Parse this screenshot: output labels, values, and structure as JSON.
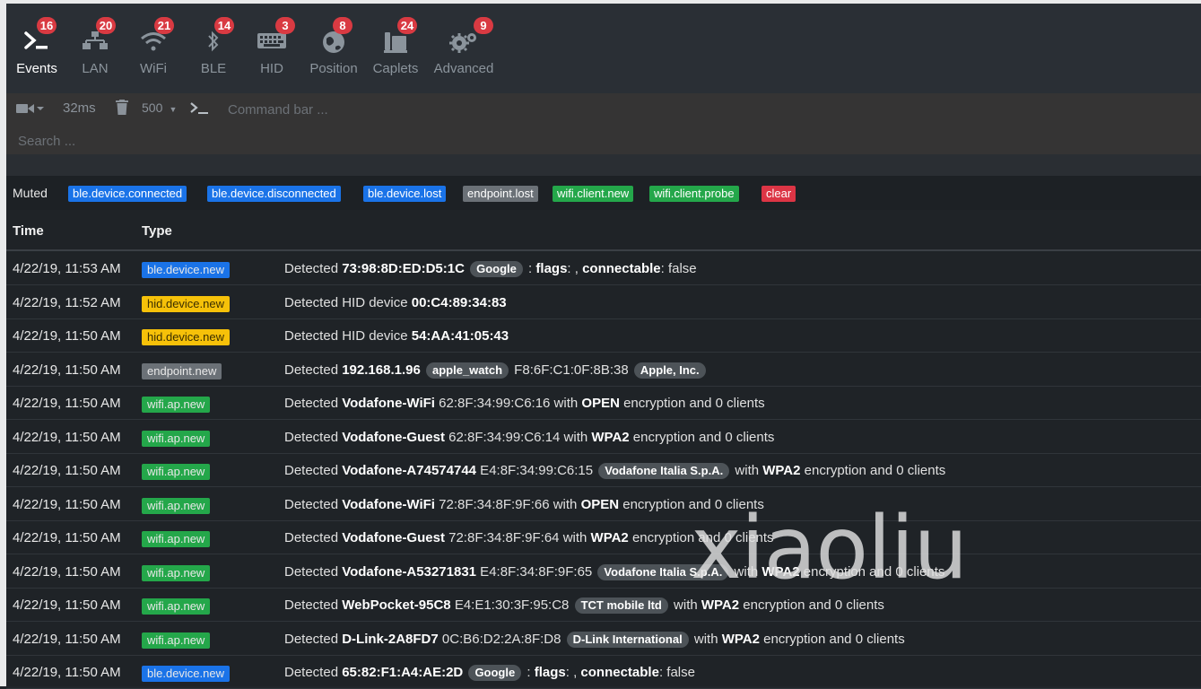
{
  "nav": {
    "items": [
      {
        "label": "Events",
        "badge": "16",
        "icon": "terminal-icon"
      },
      {
        "label": "LAN",
        "badge": "20",
        "icon": "network-icon"
      },
      {
        "label": "WiFi",
        "badge": "21",
        "icon": "wifi-icon"
      },
      {
        "label": "BLE",
        "badge": "14",
        "icon": "bluetooth-icon"
      },
      {
        "label": "HID",
        "badge": "3",
        "icon": "keyboard-icon"
      },
      {
        "label": "Position",
        "badge": "8",
        "icon": "globe-icon"
      },
      {
        "label": "Caplets",
        "badge": "24",
        "icon": "caplets-icon"
      },
      {
        "label": "Advanced",
        "badge": "9",
        "icon": "gears-icon"
      }
    ]
  },
  "toolbar": {
    "refresh": "32ms",
    "limit": "500",
    "command_placeholder": "Command bar ...",
    "search_placeholder": "Search ..."
  },
  "muted": {
    "label": "Muted",
    "tags": [
      "ble.device.connected",
      "ble.device.disconnected",
      "ble.device.lost",
      "endpoint.lost",
      "wifi.client.new",
      "wifi.client.probe"
    ],
    "clear_label": "clear"
  },
  "table": {
    "headers": {
      "time": "Time",
      "type": "Type"
    },
    "rows": [
      {
        "time": "4/22/19, 11:53 AM",
        "type": "ble.device.new",
        "msg": [
          {
            "t": "Detected "
          },
          {
            "t": "73:98:8D:ED:D5:1C",
            "b": 1
          },
          {
            "t": " "
          },
          {
            "t": "Google",
            "p": 1
          },
          {
            "t": " : "
          },
          {
            "t": "flags",
            "b": 1
          },
          {
            "t": ": , "
          },
          {
            "t": "connectable",
            "b": 1
          },
          {
            "t": ": false"
          }
        ]
      },
      {
        "time": "4/22/19, 11:52 AM",
        "type": "hid.device.new",
        "msg": [
          {
            "t": "Detected HID device "
          },
          {
            "t": "00:C4:89:34:83",
            "b": 1
          }
        ]
      },
      {
        "time": "4/22/19, 11:50 AM",
        "type": "hid.device.new",
        "msg": [
          {
            "t": "Detected HID device "
          },
          {
            "t": "54:AA:41:05:43",
            "b": 1
          }
        ]
      },
      {
        "time": "4/22/19, 11:50 AM",
        "type": "endpoint.new",
        "msg": [
          {
            "t": "Detected "
          },
          {
            "t": "192.168.1.96",
            "b": 1
          },
          {
            "t": " "
          },
          {
            "t": "apple_watch",
            "p": 1
          },
          {
            "t": " F8:6F:C1:0F:8B:38 "
          },
          {
            "t": "Apple, Inc.",
            "p": 1
          }
        ]
      },
      {
        "time": "4/22/19, 11:50 AM",
        "type": "wifi.ap.new",
        "msg": [
          {
            "t": "Detected "
          },
          {
            "t": "Vodafone-WiFi",
            "b": 1
          },
          {
            "t": " 62:8F:34:99:C6:16 with "
          },
          {
            "t": "OPEN",
            "b": 1
          },
          {
            "t": " encryption and 0 clients"
          }
        ]
      },
      {
        "time": "4/22/19, 11:50 AM",
        "type": "wifi.ap.new",
        "msg": [
          {
            "t": "Detected "
          },
          {
            "t": "Vodafone-Guest",
            "b": 1
          },
          {
            "t": " 62:8F:34:99:C6:14 with "
          },
          {
            "t": "WPA2",
            "b": 1
          },
          {
            "t": " encryption and 0 clients"
          }
        ]
      },
      {
        "time": "4/22/19, 11:50 AM",
        "type": "wifi.ap.new",
        "msg": [
          {
            "t": "Detected "
          },
          {
            "t": "Vodafone-A74574744",
            "b": 1
          },
          {
            "t": " E4:8F:34:99:C6:15 "
          },
          {
            "t": "Vodafone Italia S.p.A.",
            "p": 1
          },
          {
            "t": " with "
          },
          {
            "t": "WPA2",
            "b": 1
          },
          {
            "t": " encryption and 0 clients"
          }
        ]
      },
      {
        "time": "4/22/19, 11:50 AM",
        "type": "wifi.ap.new",
        "msg": [
          {
            "t": "Detected "
          },
          {
            "t": "Vodafone-WiFi",
            "b": 1
          },
          {
            "t": " 72:8F:34:8F:9F:66 with "
          },
          {
            "t": "OPEN",
            "b": 1
          },
          {
            "t": " encryption and 0 clients"
          }
        ]
      },
      {
        "time": "4/22/19, 11:50 AM",
        "type": "wifi.ap.new",
        "msg": [
          {
            "t": "Detected "
          },
          {
            "t": "Vodafone-Guest",
            "b": 1
          },
          {
            "t": " 72:8F:34:8F:9F:64 with "
          },
          {
            "t": "WPA2",
            "b": 1
          },
          {
            "t": " encryption and 0 clients"
          }
        ]
      },
      {
        "time": "4/22/19, 11:50 AM",
        "type": "wifi.ap.new",
        "msg": [
          {
            "t": "Detected "
          },
          {
            "t": "Vodafone-A53271831",
            "b": 1
          },
          {
            "t": " E4:8F:34:8F:9F:65 "
          },
          {
            "t": "Vodafone Italia S.p.A.",
            "p": 1
          },
          {
            "t": " with "
          },
          {
            "t": "WPA2",
            "b": 1
          },
          {
            "t": " encryption and 0 clients"
          }
        ]
      },
      {
        "time": "4/22/19, 11:50 AM",
        "type": "wifi.ap.new",
        "msg": [
          {
            "t": "Detected "
          },
          {
            "t": "WebPocket-95C8",
            "b": 1
          },
          {
            "t": " E4:E1:30:3F:95:C8 "
          },
          {
            "t": "TCT mobile ltd",
            "p": 1
          },
          {
            "t": " with "
          },
          {
            "t": "WPA2",
            "b": 1
          },
          {
            "t": " encryption and 0 clients"
          }
        ]
      },
      {
        "time": "4/22/19, 11:50 AM",
        "type": "wifi.ap.new",
        "msg": [
          {
            "t": "Detected "
          },
          {
            "t": "D-Link-2A8FD7",
            "b": 1
          },
          {
            "t": " 0C:B6:D2:2A:8F:D8 "
          },
          {
            "t": "D-Link International",
            "p": 1
          },
          {
            "t": " with "
          },
          {
            "t": "WPA2",
            "b": 1
          },
          {
            "t": " encryption and 0 clients"
          }
        ]
      },
      {
        "time": "4/22/19, 11:50 AM",
        "type": "ble.device.new",
        "msg": [
          {
            "t": "Detected "
          },
          {
            "t": "65:82:F1:A4:AE:2D",
            "b": 1
          },
          {
            "t": " "
          },
          {
            "t": "Google",
            "p": 1
          },
          {
            "t": " : "
          },
          {
            "t": "flags",
            "b": 1
          },
          {
            "t": ": , "
          },
          {
            "t": "connectable",
            "b": 1
          },
          {
            "t": ": false"
          }
        ]
      }
    ]
  },
  "watermark": "xiaoliu",
  "colors": {
    "badge": "#d93a42",
    "ble": "#1a73e8",
    "hid": "#f6c109",
    "endpoint": "#6b7177",
    "wifi": "#24a74a",
    "clear": "#dc3545"
  }
}
